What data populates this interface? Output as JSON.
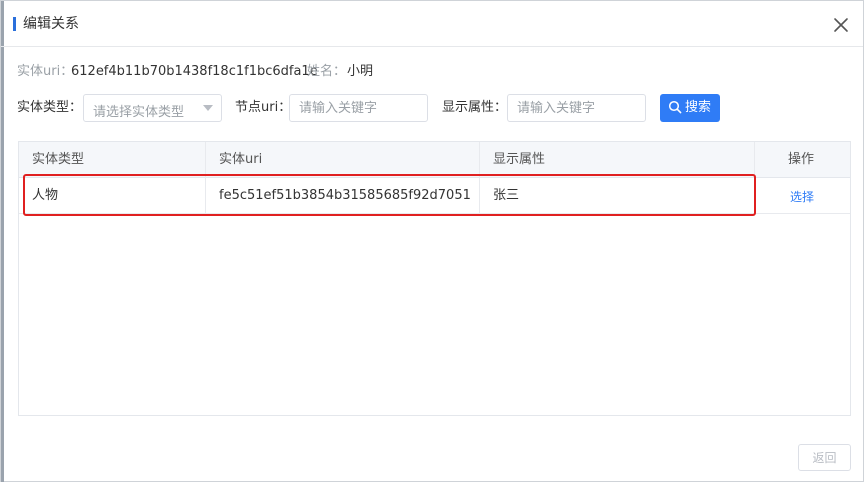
{
  "dialog": {
    "title": "编辑关系"
  },
  "info": {
    "uri_label": "实体uri：",
    "uri_value": "612ef4b11b70b1438f18c1f1bc6dfa1e",
    "name_label": "姓名：",
    "name_value": "小明"
  },
  "filters": {
    "type_label": "实体类型：",
    "type_placeholder": "请选择实体类型",
    "node_label": "节点uri：",
    "node_placeholder": "请输入关键字",
    "display_label": "显示属性：",
    "display_placeholder": "请输入关键字",
    "search_label": "搜索"
  },
  "table": {
    "columns": [
      "实体类型",
      "实体uri",
      "显示属性",
      "操作"
    ],
    "rows": [
      {
        "type": "人物",
        "uri": "fe5c51ef51b3854b31585685f92d7051",
        "display": "张三",
        "action": "选择"
      }
    ]
  },
  "footer": {
    "back_label": "返回"
  },
  "colors": {
    "accent": "#2f7cf6",
    "highlight": "#e02020",
    "title_bar": "#2a6fdb"
  }
}
